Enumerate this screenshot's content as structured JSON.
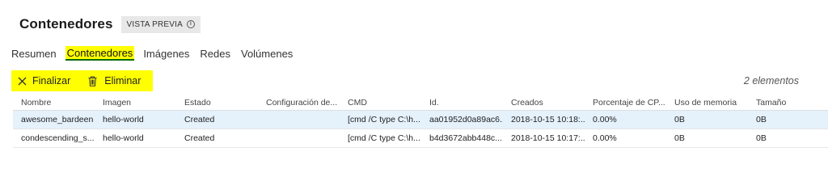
{
  "header": {
    "title": "Contenedores",
    "badge": "VISTA PREVIA",
    "badge_icon": "info-icon"
  },
  "tabs": [
    {
      "label": "Resumen"
    },
    {
      "label": "Contenedores",
      "active": true
    },
    {
      "label": "Imágenes"
    },
    {
      "label": "Redes"
    },
    {
      "label": "Volúmenes"
    }
  ],
  "toolbar": {
    "stop_icon": "close-icon",
    "stop_label": "Finalizar",
    "delete_icon": "trash-icon",
    "delete_label": "Eliminar",
    "highlight_color": "#ffff00"
  },
  "count_label": "2 elementos",
  "table": {
    "columns": [
      "Nombre",
      "Imagen",
      "Estado",
      "Configuración de...",
      "CMD",
      "Id.",
      "Creados",
      "Porcentaje de CP...",
      "Uso de memoria",
      "Tamaño"
    ],
    "rows": [
      [
        "awesome_bardeen",
        "hello-world",
        "Created",
        "",
        "[cmd /C type C:\\h...",
        "aa01952d0a89ac6...",
        "2018-10-15 10:18:...",
        "0.00%",
        "0B",
        "0B"
      ],
      [
        "condescending_s...",
        "hello-world",
        "Created",
        "",
        "[cmd /C type C:\\h...",
        "b4d3672abb448c...",
        "2018-10-15 10:17:...",
        "0.00%",
        "0B",
        "0B"
      ]
    ]
  }
}
